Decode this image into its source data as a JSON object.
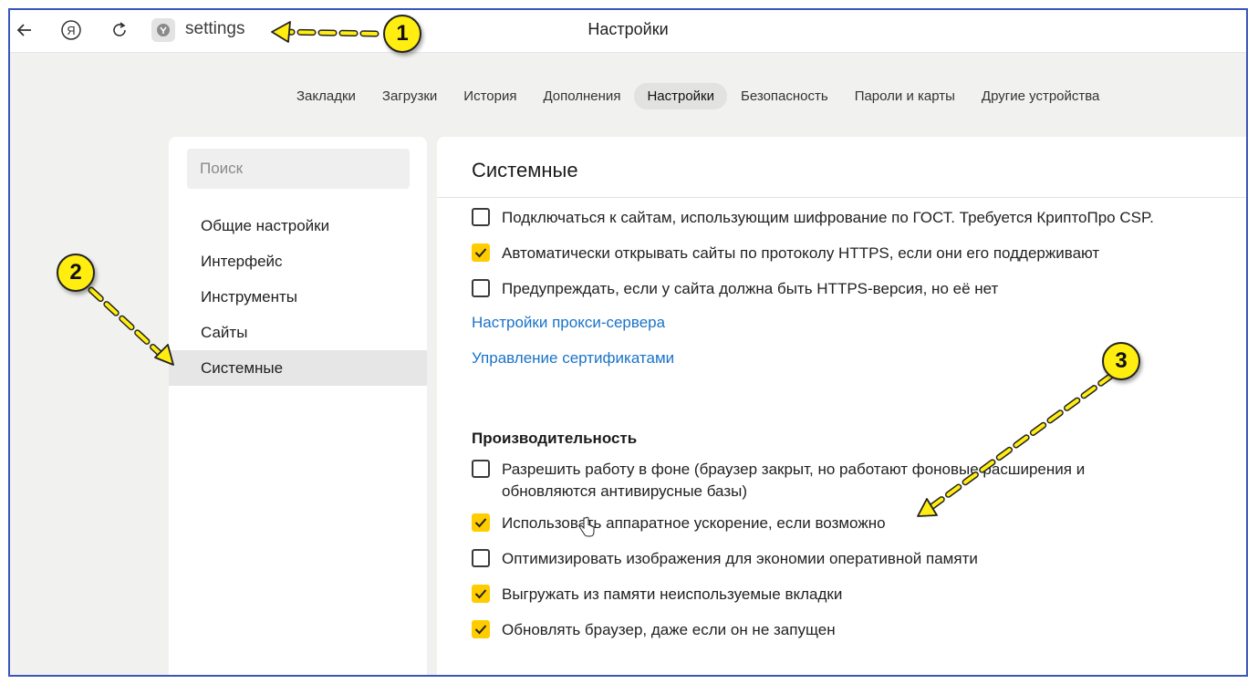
{
  "topbar": {
    "address_text": "settings",
    "window_title": "Настройки"
  },
  "tabs": [
    {
      "label": "Закладки"
    },
    {
      "label": "Загрузки"
    },
    {
      "label": "История"
    },
    {
      "label": "Дополнения"
    },
    {
      "label": "Настройки",
      "active": true
    },
    {
      "label": "Безопасность"
    },
    {
      "label": "Пароли и карты"
    },
    {
      "label": "Другие устройства"
    }
  ],
  "sidebar": {
    "search_placeholder": "Поиск",
    "items": [
      {
        "label": "Общие настройки"
      },
      {
        "label": "Интерфейс"
      },
      {
        "label": "Инструменты"
      },
      {
        "label": "Сайты"
      },
      {
        "label": "Системные",
        "active": true
      }
    ]
  },
  "main": {
    "title": "Системные",
    "network_options": [
      {
        "label": "Подключаться к сайтам, использующим шифрование по ГОСТ. Требуется КриптоПро CSP.",
        "checked": false
      },
      {
        "label": "Автоматически открывать сайты по протоколу HTTPS, если они его поддерживают",
        "checked": true
      },
      {
        "label": "Предупреждать, если у сайта должна быть HTTPS-версия, но её нет",
        "checked": false
      }
    ],
    "links": {
      "proxy": "Настройки прокси-сервера",
      "certificates": "Управление сертификатами"
    },
    "performance_heading": "Производительность",
    "performance_options": [
      {
        "label": "Разрешить работу в фоне (браузер закрыт, но работают фоновые расширения и обновляются антивирусные базы)",
        "checked": false
      },
      {
        "label": "Использовать аппаратное ускорение, если возможно",
        "checked": true
      },
      {
        "label": "Оптимизировать изображения для экономии оперативной памяти",
        "checked": false
      },
      {
        "label": "Выгружать из памяти неиспользуемые вкладки",
        "checked": true
      },
      {
        "label": "Обновлять браузер, даже если он не запущен",
        "checked": true
      }
    ]
  },
  "annotations": {
    "callout_1": "1",
    "callout_2": "2",
    "callout_3": "3"
  },
  "colors": {
    "accent_checkbox": "#ffcc00",
    "link": "#1a73c8",
    "callout_fill": "#ffee10"
  }
}
